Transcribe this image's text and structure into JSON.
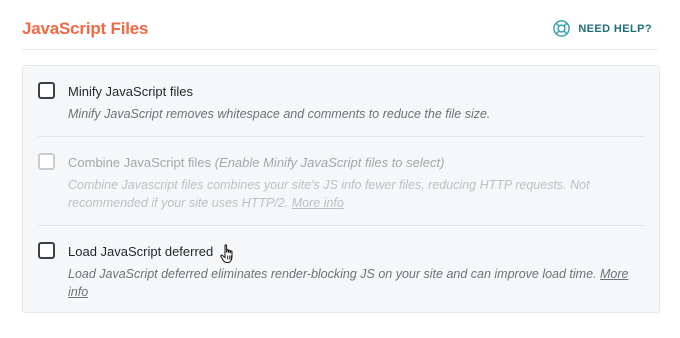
{
  "header": {
    "title": "JavaScript Files",
    "help_label": "NEED HELP?",
    "help_icon": "lifebuoy-icon"
  },
  "colors": {
    "title": "#ee6a45",
    "help": "#1f6f78",
    "panel_bg": "#f6f7f9"
  },
  "options": [
    {
      "label": "Minify JavaScript files",
      "hint": "",
      "checked": false,
      "disabled": false,
      "description": "Minify JavaScript removes whitespace and comments to reduce the file size.",
      "link": ""
    },
    {
      "label": "Combine JavaScript files",
      "hint": "(Enable Minify JavaScript files to select)",
      "checked": false,
      "disabled": true,
      "description": "Combine Javascript files combines your site's JS info fewer files, reducing HTTP requests. Not recommended if your site uses HTTP/2.",
      "link": "More info"
    },
    {
      "label": "Load JavaScript deferred",
      "hint": "",
      "checked": false,
      "disabled": false,
      "description": "Load JavaScript deferred eliminates render-blocking JS on your site and can improve load time.",
      "link": "More info"
    }
  ],
  "cursor_icon": "hand-pointer-icon"
}
